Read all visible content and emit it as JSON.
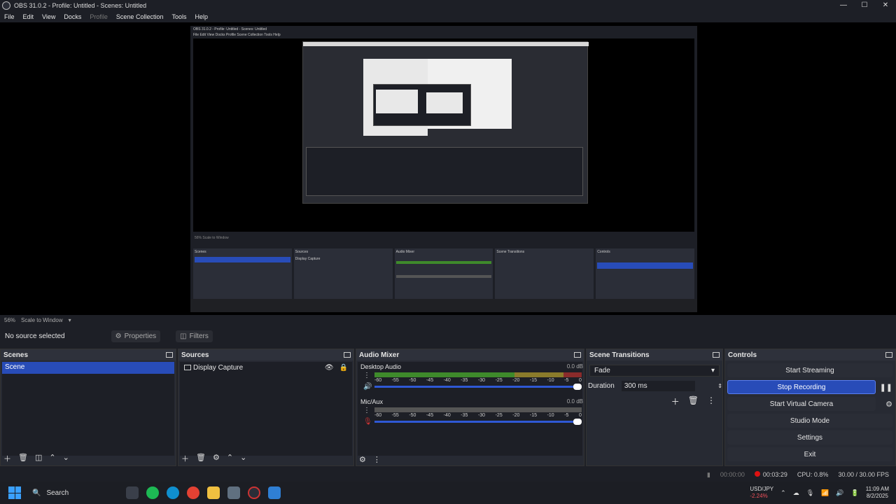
{
  "window": {
    "title": "OBS 31.0.2 - Profile: Untitled - Scenes: Untitled",
    "min": "—",
    "max": "☐",
    "close": "✕"
  },
  "menu": [
    "File",
    "Edit",
    "View",
    "Docks",
    "Profile",
    "Scene Collection",
    "Tools",
    "Help"
  ],
  "preview": {
    "zoom": "56%",
    "scale_mode": "Scale to Window"
  },
  "source_bar": {
    "no_source": "No source selected",
    "properties": "Properties",
    "filters": "Filters"
  },
  "scenes": {
    "title": "Scenes",
    "items": [
      "Scene"
    ]
  },
  "sources": {
    "title": "Sources",
    "items": [
      "Display Capture"
    ]
  },
  "mixer": {
    "title": "Audio Mixer",
    "ticks": [
      "-60",
      "-55",
      "-50",
      "-45",
      "-40",
      "-35",
      "-30",
      "-25",
      "-20",
      "-15",
      "-10",
      "-5",
      "0"
    ],
    "channels": [
      {
        "name": "Desktop Audio",
        "db": "0.0 dB"
      },
      {
        "name": "Mic/Aux",
        "db": "0.0 dB"
      }
    ]
  },
  "transitions": {
    "title": "Scene Transitions",
    "selected": "Fade",
    "duration_label": "Duration",
    "duration_value": "300 ms"
  },
  "controls": {
    "title": "Controls",
    "start_streaming": "Start Streaming",
    "stop_recording": "Stop Recording",
    "start_virtual_camera": "Start Virtual Camera",
    "studio_mode": "Studio Mode",
    "settings": "Settings",
    "exit": "Exit"
  },
  "status": {
    "stream_time": "00:00:00",
    "rec_time": "00:03:29",
    "cpu": "CPU: 0.8%",
    "fps": "30.00 / 30.00 FPS"
  },
  "nested": {
    "title": "OBS 31.0.2 - Profile: Untitled - Scenes: Untitled",
    "menu": "File  Edit  View  Docks  Profile  Scene Collection  Tools  Help",
    "strip": "56%   Scale to Window",
    "no_source": "No source selected",
    "scenes": "Scenes",
    "scene_item": "Scene",
    "sources": "Sources",
    "source_item": "Display Capture",
    "mixer": "Audio Mixer",
    "transitions": "Scene Transitions",
    "controls": "Controls",
    "stop_recording": "Stop Recording",
    "search": "Search"
  },
  "taskbar": {
    "search": "Search",
    "stock_name": "USD/JPY",
    "stock_change": "-2.24%",
    "time": "11:09 AM",
    "date": "8/2/2025"
  },
  "colors": {
    "accent": "#284cb8",
    "recording": "#dd1111",
    "meter_green": "#3e8a2b"
  }
}
